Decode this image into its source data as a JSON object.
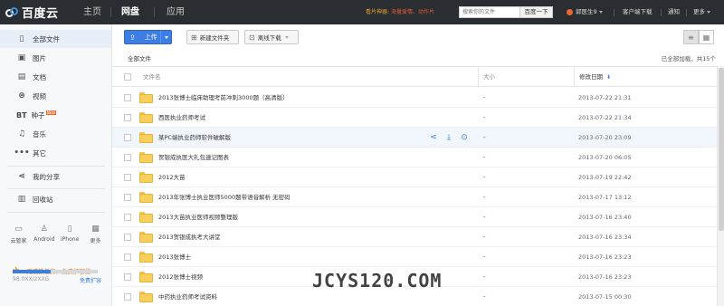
{
  "app": {
    "logo_text": "百度云",
    "nav": [
      "主页",
      "网盘",
      "应用"
    ],
    "promo_label": "看片神器:",
    "promo_text": "海量爱情、动作片",
    "search_placeholder": "搜索你的文件",
    "search_button": "百度一下",
    "username": "郭医生9",
    "top_links": [
      "客户端下载",
      "通知",
      "更多"
    ]
  },
  "sidebar": {
    "items": [
      {
        "label": "全部文件",
        "icon": "file-icon"
      },
      {
        "label": "图片",
        "icon": "image-icon"
      },
      {
        "label": "文档",
        "icon": "document-icon"
      },
      {
        "label": "视频",
        "icon": "video-icon"
      },
      {
        "label": "种子",
        "icon": "bt-icon",
        "badge": "NEW"
      },
      {
        "label": "音乐",
        "icon": "music-icon"
      },
      {
        "label": "其它",
        "icon": "more-dots-icon"
      }
    ],
    "share_label": "我的分享",
    "recycle_label": "回收站",
    "devices": [
      "云管家",
      "Android",
      "iPhone",
      "更多"
    ],
    "task_text": "完成新任务，免费扩容量",
    "quota_text": "98.0XX/2XXG",
    "quota_fraction": 0.45,
    "expand_label": "免费扩容"
  },
  "toolbar": {
    "upload_label": "上传",
    "new_folder_label": "新建文件夹",
    "offline_download_label": "离线下载"
  },
  "list": {
    "breadcrumb": "全部文件",
    "loaded_text": "已全部加载，共15个",
    "columns": {
      "name": "文件名",
      "size": "大小",
      "date": "修改日期"
    },
    "rows": [
      {
        "name": "2013张博士临床助理考前冲刺3000题（高清版）",
        "size": "-",
        "date": "2013-07-22 21:31"
      },
      {
        "name": "西医执业药师考试",
        "size": "-",
        "date": "2013-07-22 21:34"
      },
      {
        "name": "某PC端执业药师软件破解版",
        "size": "-",
        "date": "2013-07-20 23:09"
      },
      {
        "name": "贺银成执医大礼包速记图表",
        "size": "-",
        "date": "2013-07-20 06:05"
      },
      {
        "name": "2012大苗",
        "size": "-",
        "date": "2013-07-19 22:42"
      },
      {
        "name": "2013年张博士执业医师5000题带语音解析 无密码",
        "size": "-",
        "date": "2013-07-17 13:12"
      },
      {
        "name": "2013大苗执业医师视频整理版",
        "size": "-",
        "date": "2013-07-16 23:40"
      },
      {
        "name": "2013贺银成执考大讲堂",
        "size": "-",
        "date": "2013-07-16 23:34"
      },
      {
        "name": "2013张博士",
        "size": "-",
        "date": "2013-07-16 23:23"
      },
      {
        "name": "2012张博士视频",
        "size": "-",
        "date": "2013-07-16 23:23"
      },
      {
        "name": "中药执业药师考试资料",
        "size": "-",
        "date": "2013-07-15 00:30"
      }
    ]
  },
  "watermark": "JCYS120.COM"
}
